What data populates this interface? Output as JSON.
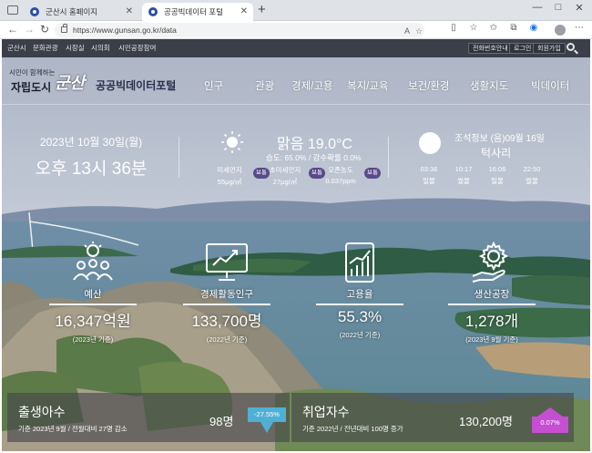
{
  "browser": {
    "tabs": [
      {
        "label": "군산시 홈페이지"
      },
      {
        "label": "공공빅데이터 포털"
      }
    ],
    "new_tab": "+",
    "window_controls": [
      "—",
      "□",
      "✕"
    ],
    "url": "https://www.gunsan.go.kr/data"
  },
  "site": {
    "utility_links": [
      "군산시",
      "문화관광",
      "시장실",
      "시의회",
      "시민공장참여"
    ],
    "utility_buttons": [
      "전화번호안내",
      "로그인",
      "회원가입"
    ],
    "logo": {
      "slogan": "시민이 함께하는",
      "city": "자립도시",
      "brand": "군산"
    },
    "portal_title": "공공빅데이터포털",
    "menu": [
      "인구",
      "관광",
      "경제/고용",
      "복지/교육",
      "보건/환경",
      "생활지도",
      "빅데이터"
    ]
  },
  "info": {
    "date": "2023년 10월 30일(월)",
    "time": "오후 13시 36분",
    "weather": {
      "condition": "맑음 19.0°C",
      "detail": "습도: 65.0% / 강수확률 0.0%",
      "air": [
        {
          "label": "미세먼지",
          "value": "55μg/㎥",
          "status": "보통"
        },
        {
          "label": "초미세먼지",
          "value": "27μg/㎥",
          "status": "보통"
        },
        {
          "label": "오존농도",
          "value": "0.037ppm",
          "status": "보통"
        }
      ]
    },
    "tide": {
      "title": "조석정보 (음)09월 16일",
      "level": "턱사리",
      "times": [
        {
          "time": "03:36",
          "type": "밀물"
        },
        {
          "time": "10:17",
          "type": "썰물"
        },
        {
          "time": "16:06",
          "type": "밀물"
        },
        {
          "time": "22:50",
          "type": "썰물"
        }
      ]
    }
  },
  "stats": [
    {
      "label": "예산",
      "value": "16,347억원",
      "note": "(2023년 기준)",
      "icon": "people-idea-icon"
    },
    {
      "label": "경제활동인구",
      "value": "133,700명",
      "note": "(2022년 기준)",
      "icon": "presentation-icon"
    },
    {
      "label": "고용율",
      "value": "55.3%",
      "note": "(2022년 기준)",
      "icon": "growth-chart-icon"
    },
    {
      "label": "생산공장",
      "value": "1,278개",
      "note": "(2023년 9월 기준)",
      "icon": "gear-hand-icon"
    }
  ],
  "panels": [
    {
      "title": "출생아수",
      "sub": "기준 2023년 9월 / 전월대비 27명 감소",
      "value": "98명",
      "change": "-27.55%",
      "direction": "down",
      "color": "#4fb0d6"
    },
    {
      "title": "취업자수",
      "sub": "기준 2022년 / 전년대비 100명 증가",
      "value": "130,200명",
      "change": "0.07%",
      "direction": "up",
      "color": "#c54fd0"
    }
  ]
}
